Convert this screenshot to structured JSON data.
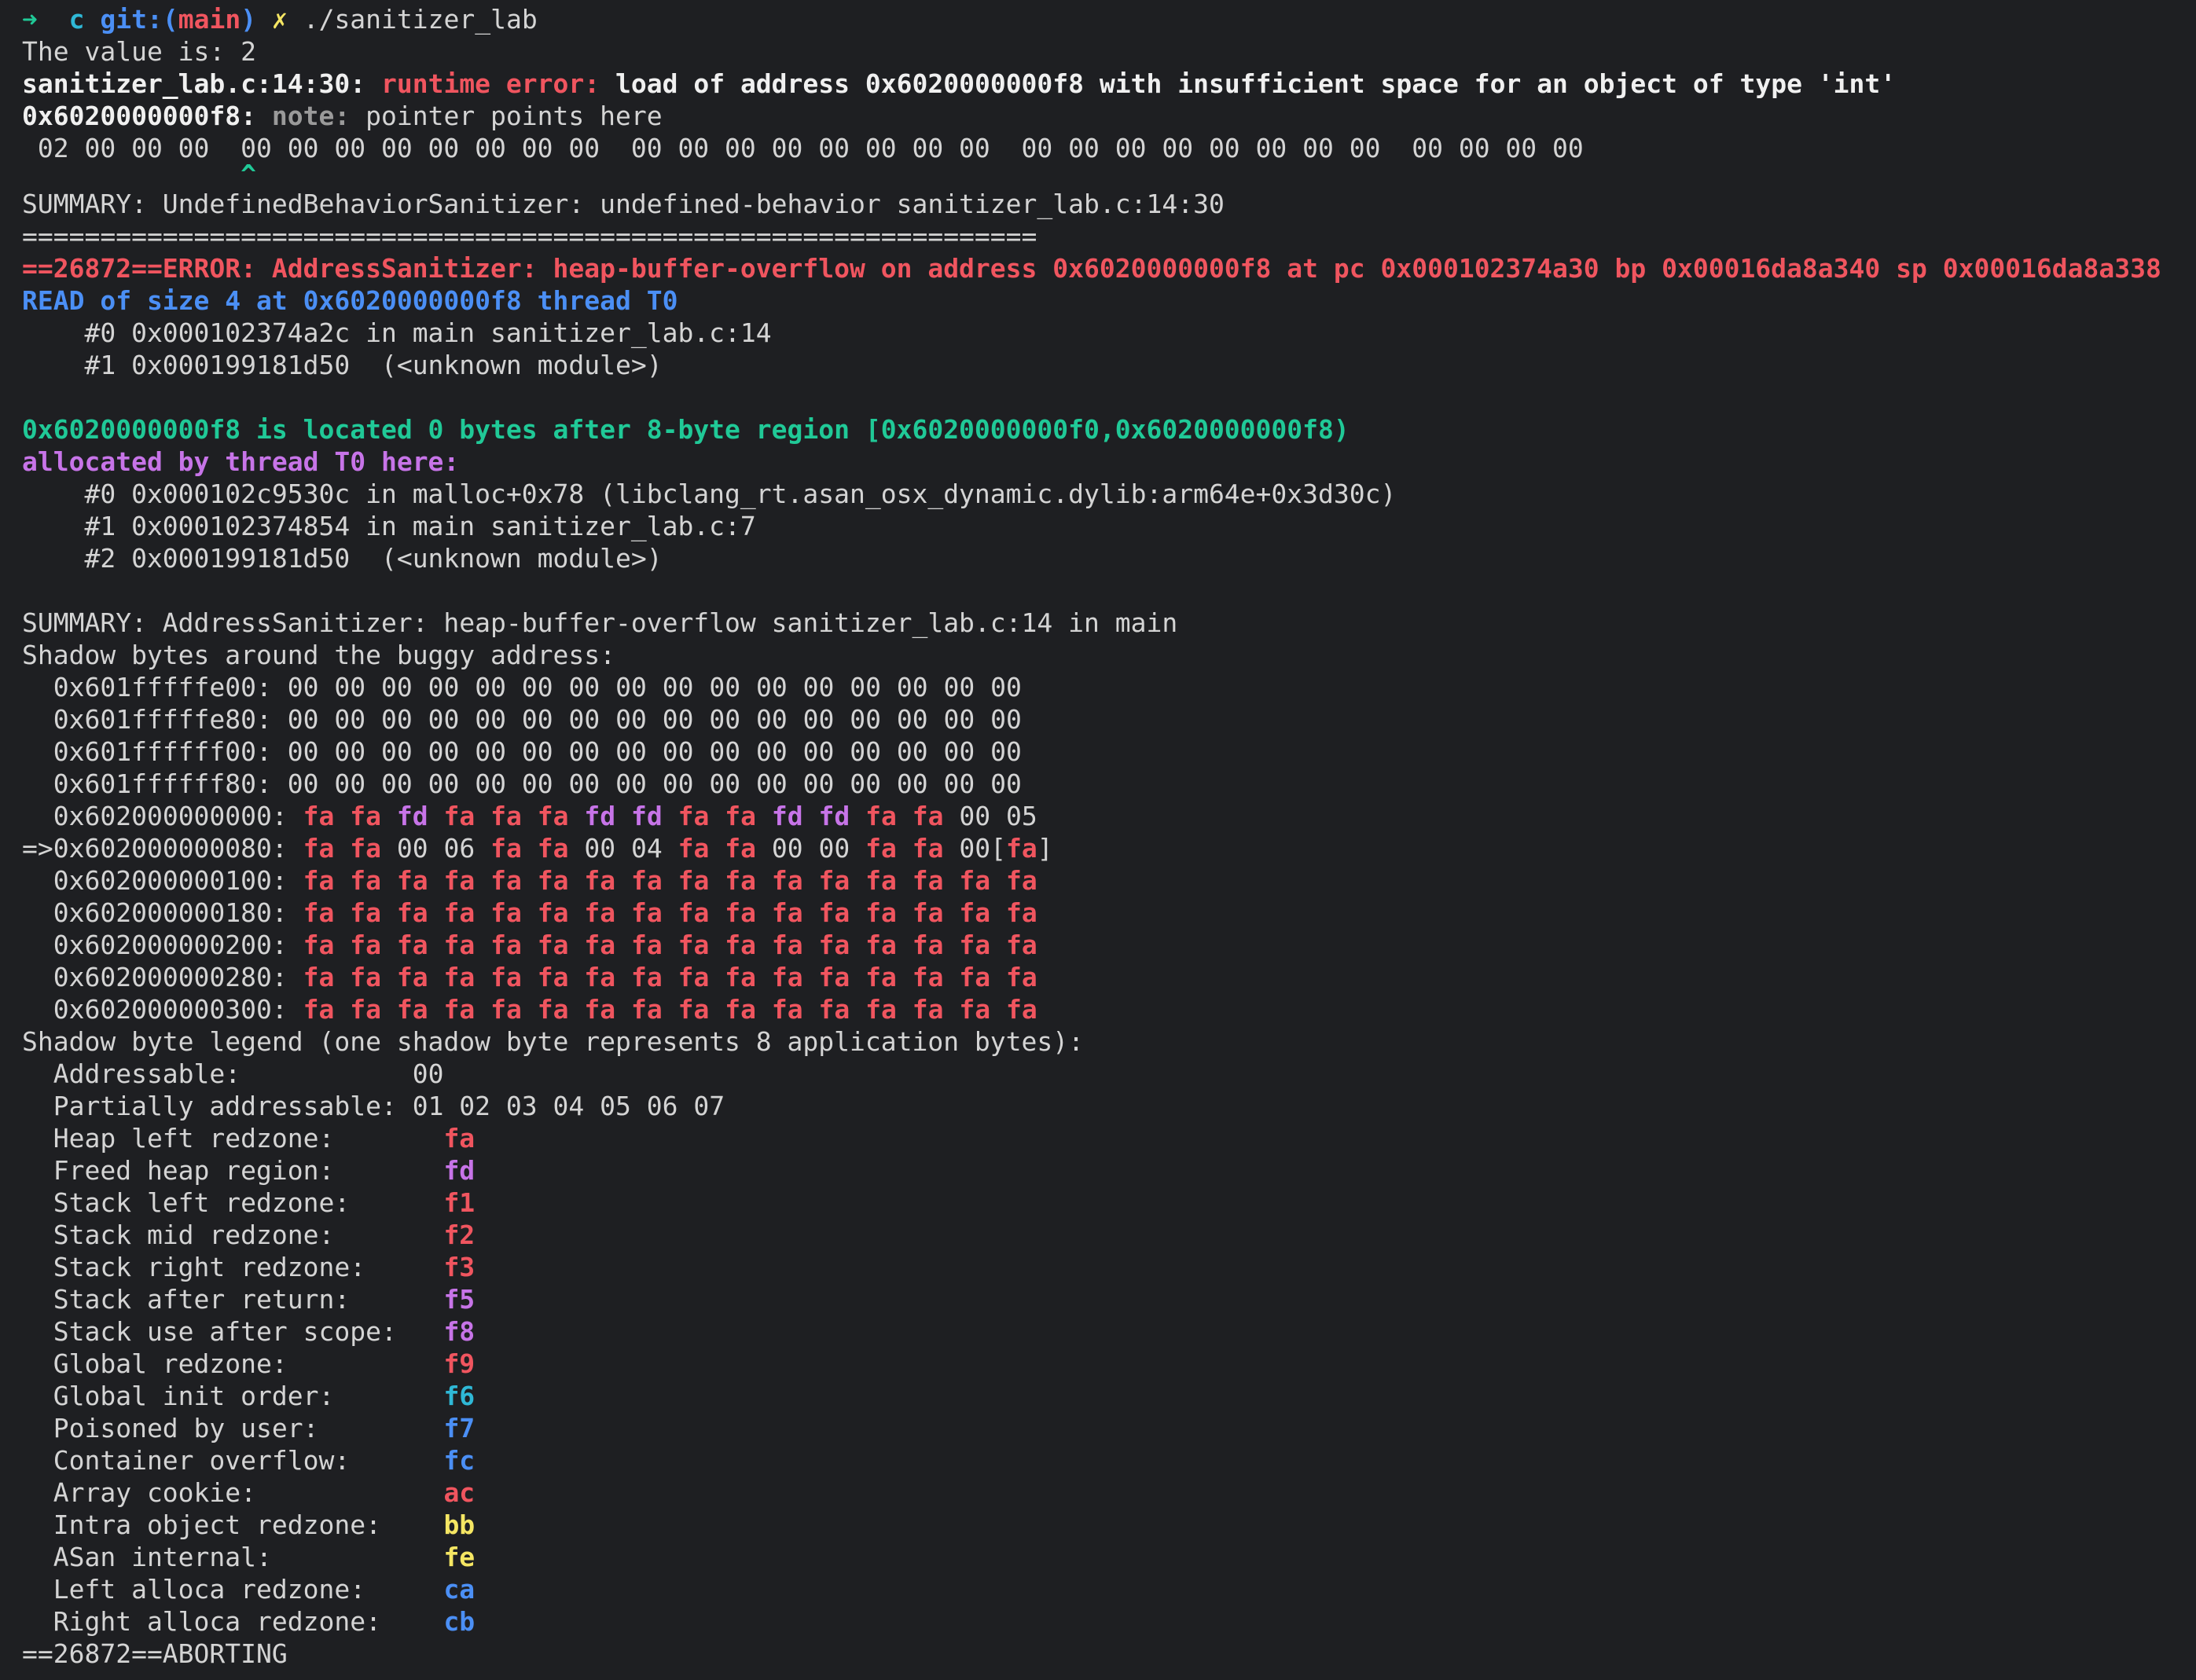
{
  "prompt": {
    "arrow": "➜",
    "dir": "c",
    "git_prefix": "git:(",
    "branch": "main",
    "git_suffix": ")",
    "dirty": "✗",
    "command": "./sanitizer_lab"
  },
  "value_line": "The value is: 2",
  "ubsan": {
    "location": "sanitizer_lab.c:14:30:",
    "error_label": "runtime error:",
    "message": "load of address 0x6020000000f8 with insufficient space for an object of type 'int'",
    "note_addr": "0x6020000000f8:",
    "note_label": "note:",
    "note_text": "pointer points here",
    "bytes_line": " 02 00 00 00  00 00 00 00 00 00 00 00  00 00 00 00 00 00 00 00  00 00 00 00 00 00 00 00  00 00 00 00",
    "caret_line": "              ^",
    "summary": "SUMMARY: UndefinedBehaviorSanitizer: undefined-behavior sanitizer_lab.c:14:30"
  },
  "separator": "=================================================================",
  "asan": {
    "error_line": "==26872==ERROR: AddressSanitizer: heap-buffer-overflow on address 0x6020000000f8 at pc 0x000102374a30 bp 0x00016da8a340 sp 0x00016da8a338",
    "read_line": "READ of size 4 at 0x6020000000f8 thread T0",
    "stack": [
      "    #0 0x000102374a2c in main sanitizer_lab.c:14",
      "    #1 0x000199181d50  (<unknown module>)"
    ],
    "located_line": "0x6020000000f8 is located 0 bytes after 8-byte region [0x6020000000f0,0x6020000000f8)",
    "allocated_line": "allocated by thread T0 here:",
    "alloc_stack": [
      "    #0 0x000102c9530c in malloc+0x78 (libclang_rt.asan_osx_dynamic.dylib:arm64e+0x3d30c)",
      "    #1 0x000102374854 in main sanitizer_lab.c:7",
      "    #2 0x000199181d50  (<unknown module>)"
    ],
    "summary": "SUMMARY: AddressSanitizer: heap-buffer-overflow sanitizer_lab.c:14 in main",
    "shadow_header": "Shadow bytes around the buggy address:",
    "shadow_rows": [
      {
        "prefix": "  ",
        "addr": "0x601fffffe00:",
        "bytes": [
          "00",
          "00",
          "00",
          "00",
          "00",
          "00",
          "00",
          "00",
          "00",
          "00",
          "00",
          "00",
          "00",
          "00",
          "00",
          "00"
        ]
      },
      {
        "prefix": "  ",
        "addr": "0x601fffffe80:",
        "bytes": [
          "00",
          "00",
          "00",
          "00",
          "00",
          "00",
          "00",
          "00",
          "00",
          "00",
          "00",
          "00",
          "00",
          "00",
          "00",
          "00"
        ]
      },
      {
        "prefix": "  ",
        "addr": "0x601ffffff00:",
        "bytes": [
          "00",
          "00",
          "00",
          "00",
          "00",
          "00",
          "00",
          "00",
          "00",
          "00",
          "00",
          "00",
          "00",
          "00",
          "00",
          "00"
        ]
      },
      {
        "prefix": "  ",
        "addr": "0x601ffffff80:",
        "bytes": [
          "00",
          "00",
          "00",
          "00",
          "00",
          "00",
          "00",
          "00",
          "00",
          "00",
          "00",
          "00",
          "00",
          "00",
          "00",
          "00"
        ]
      },
      {
        "prefix": "  ",
        "addr": "0x602000000000:",
        "bytes": [
          "fa",
          "fa",
          "fd",
          "fa",
          "fa",
          "fa",
          "fd",
          "fd",
          "fa",
          "fa",
          "fd",
          "fd",
          "fa",
          "fa",
          "00",
          "05"
        ]
      },
      {
        "prefix": "=>",
        "addr": "0x602000000080:",
        "bytes": [
          "fa",
          "fa",
          "00",
          "06",
          "fa",
          "fa",
          "00",
          "04",
          "fa",
          "fa",
          "00",
          "00",
          "fa",
          "fa",
          "00",
          "fa"
        ],
        "highlight": 15
      },
      {
        "prefix": "  ",
        "addr": "0x602000000100:",
        "bytes": [
          "fa",
          "fa",
          "fa",
          "fa",
          "fa",
          "fa",
          "fa",
          "fa",
          "fa",
          "fa",
          "fa",
          "fa",
          "fa",
          "fa",
          "fa",
          "fa"
        ]
      },
      {
        "prefix": "  ",
        "addr": "0x602000000180:",
        "bytes": [
          "fa",
          "fa",
          "fa",
          "fa",
          "fa",
          "fa",
          "fa",
          "fa",
          "fa",
          "fa",
          "fa",
          "fa",
          "fa",
          "fa",
          "fa",
          "fa"
        ]
      },
      {
        "prefix": "  ",
        "addr": "0x602000000200:",
        "bytes": [
          "fa",
          "fa",
          "fa",
          "fa",
          "fa",
          "fa",
          "fa",
          "fa",
          "fa",
          "fa",
          "fa",
          "fa",
          "fa",
          "fa",
          "fa",
          "fa"
        ]
      },
      {
        "prefix": "  ",
        "addr": "0x602000000280:",
        "bytes": [
          "fa",
          "fa",
          "fa",
          "fa",
          "fa",
          "fa",
          "fa",
          "fa",
          "fa",
          "fa",
          "fa",
          "fa",
          "fa",
          "fa",
          "fa",
          "fa"
        ]
      },
      {
        "prefix": "  ",
        "addr": "0x602000000300:",
        "bytes": [
          "fa",
          "fa",
          "fa",
          "fa",
          "fa",
          "fa",
          "fa",
          "fa",
          "fa",
          "fa",
          "fa",
          "fa",
          "fa",
          "fa",
          "fa",
          "fa"
        ]
      }
    ],
    "legend_header": "Shadow byte legend (one shadow byte represents 8 application bytes):",
    "legend": [
      {
        "label": "  Addressable:           ",
        "value": "00",
        "color": "w"
      },
      {
        "label": "  Partially addressable: ",
        "value": "01 02 03 04 05 06 07",
        "color": "w"
      },
      {
        "label": "  Heap left redzone:       ",
        "value": "fa",
        "color": "redb"
      },
      {
        "label": "  Freed heap region:       ",
        "value": "fd",
        "color": "mag"
      },
      {
        "label": "  Stack left redzone:      ",
        "value": "f1",
        "color": "redb"
      },
      {
        "label": "  Stack mid redzone:       ",
        "value": "f2",
        "color": "redb"
      },
      {
        "label": "  Stack right redzone:     ",
        "value": "f3",
        "color": "redb"
      },
      {
        "label": "  Stack after return:      ",
        "value": "f5",
        "color": "mag"
      },
      {
        "label": "  Stack use after scope:   ",
        "value": "f8",
        "color": "mag"
      },
      {
        "label": "  Global redzone:          ",
        "value": "f9",
        "color": "redb"
      },
      {
        "label": "  Global init order:       ",
        "value": "f6",
        "color": "cyanb"
      },
      {
        "label": "  Poisoned by user:        ",
        "value": "f7",
        "color": "blueb"
      },
      {
        "label": "  Container overflow:      ",
        "value": "fc",
        "color": "blueb"
      },
      {
        "label": "  Array cookie:            ",
        "value": "ac",
        "color": "redb"
      },
      {
        "label": "  Intra object redzone:    ",
        "value": "bb",
        "color": "yellow"
      },
      {
        "label": "  ASan internal:           ",
        "value": "fe",
        "color": "yellow"
      },
      {
        "label": "  Left alloca redzone:     ",
        "value": "ca",
        "color": "blueb"
      },
      {
        "label": "  Right alloca redzone:    ",
        "value": "cb",
        "color": "blueb"
      }
    ],
    "aborting": "==26872==ABORTING"
  },
  "colors": {
    "background": "#1e1f22",
    "text": "#d4d4d4",
    "red": "#f0555f",
    "blue": "#4b8ff5",
    "green": "#20c997",
    "magenta": "#c774e8",
    "yellow": "#f5e663",
    "cyan": "#2fb8d6"
  }
}
